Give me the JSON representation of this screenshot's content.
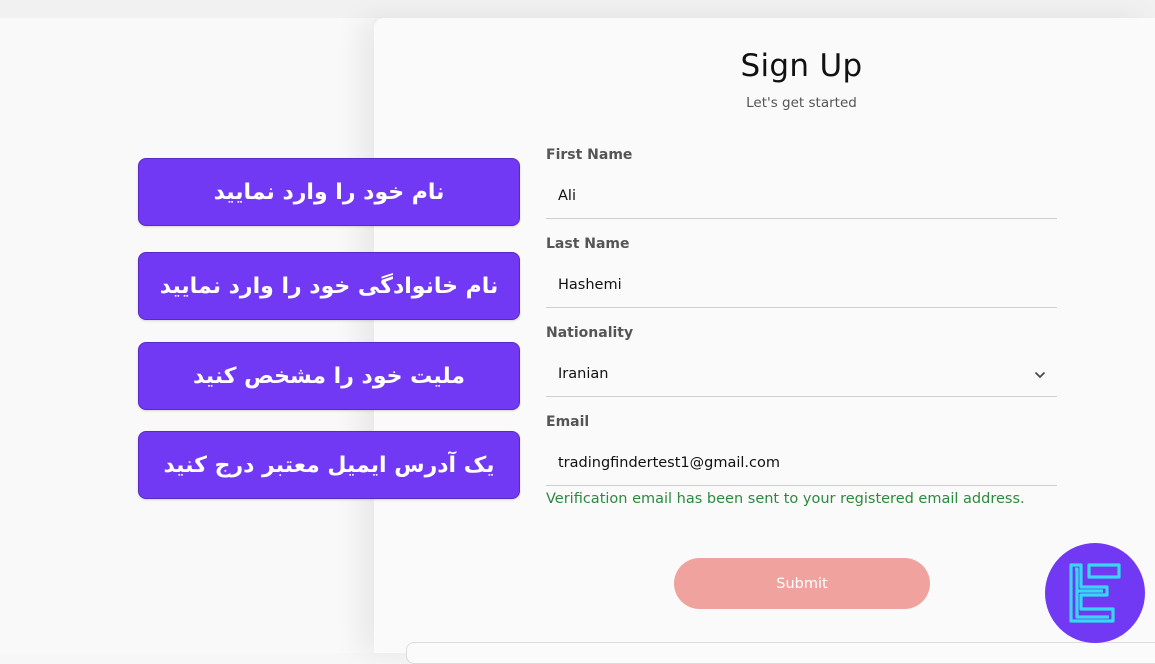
{
  "form": {
    "title": "Sign Up",
    "subtitle": "Let's get started",
    "first_name": {
      "label": "First Name",
      "value": "Ali"
    },
    "last_name": {
      "label": "Last Name",
      "value": "Hashemi"
    },
    "nationality": {
      "label": "Nationality",
      "value": "Iranian"
    },
    "email": {
      "label": "Email",
      "value": "tradingfindertest1@gmail.com",
      "status": "Verification email has been sent to your registered email address."
    },
    "submit_label": "Submit"
  },
  "annotations": [
    "نام خود را وارد نمایید",
    "نام خانوادگی خود را وارد نمایید",
    "ملیت خود را مشخص کنید",
    "یک آدرس ایمیل معتبر درج کنید"
  ],
  "colors": {
    "annotation_bg": "#7139f4",
    "submit_bg": "#f0a29f",
    "status_text": "#2b8a3e",
    "logo_bg": "#7139f4",
    "logo_stroke": "#35d8f0"
  },
  "icons": {
    "nationality_dropdown": "chevron-down-icon",
    "brand": "tradingfinder-logo-icon"
  }
}
